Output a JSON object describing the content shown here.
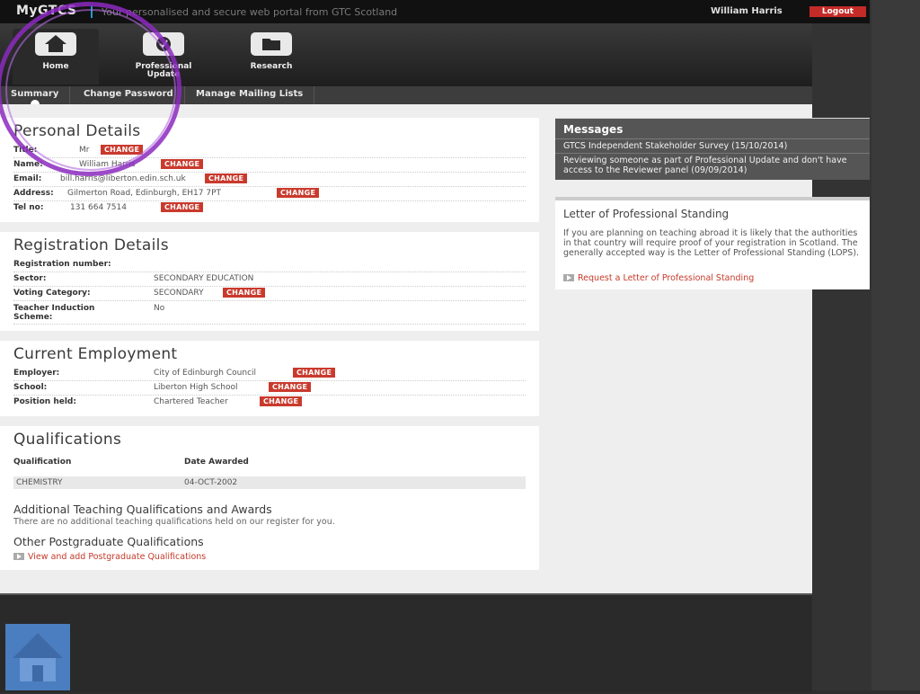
{
  "header": {
    "logo": "MyGTCS",
    "tagline": "Your personalised and secure web portal from GTC Scotland",
    "username": "William Harris",
    "logout": "Logout"
  },
  "nav": [
    {
      "label": "Home",
      "icon": "home-icon"
    },
    {
      "label": "Professional Update",
      "icon": "professional-update-icon"
    },
    {
      "label": "Research",
      "icon": "folder-icon"
    }
  ],
  "subtabs": [
    "Summary",
    "Change Password",
    "Manage Mailing Lists"
  ],
  "change_label": "CHANGE",
  "personal": {
    "title": "Personal Details",
    "rows": [
      {
        "label": "Title:",
        "value": "Mr"
      },
      {
        "label": "Name:",
        "value": "William Harris"
      },
      {
        "label": "Email:",
        "value": "bill.harris@liberton.edin.sch.uk"
      },
      {
        "label": "Address:",
        "value": "Gilmerton Road, Edinburgh, EH17 7PT"
      },
      {
        "label": "Tel no:",
        "value": "131 664 7514"
      }
    ]
  },
  "registration": {
    "title": "Registration Details",
    "rows": [
      {
        "label": "Registration number:",
        "value": ""
      },
      {
        "label": "Sector:",
        "value": "SECONDARY EDUCATION"
      },
      {
        "label": "Voting Category:",
        "value": "SECONDARY"
      },
      {
        "label": "Teacher Induction Scheme:",
        "value": "No"
      }
    ]
  },
  "employment": {
    "title": "Current Employment",
    "rows": [
      {
        "label": "Employer:",
        "value": "City of Edinburgh Council"
      },
      {
        "label": "School:",
        "value": "Liberton High School"
      },
      {
        "label": "Position held:",
        "value": "Chartered Teacher"
      }
    ]
  },
  "qualifications": {
    "title": "Qualifications",
    "col_qual": "Qualification",
    "col_date": "Date Awarded",
    "rows": [
      {
        "qualification": "CHEMISTRY",
        "date": "04-OCT-2002"
      }
    ],
    "additional_title": "Additional Teaching Qualifications and Awards",
    "additional_text": "There are no additional teaching qualifications held on our register for you.",
    "postgrad_title": "Other Postgraduate Qualifications",
    "postgrad_link": "View and add Postgraduate Qualifications"
  },
  "messages": {
    "title": "Messages",
    "items": [
      "GTCS Independent Stakeholder Survey (15/10/2014)",
      "Reviewing someone as part of Professional Update and don't have access to the Reviewer panel (09/09/2014)"
    ]
  },
  "lops": {
    "title": "Letter of Professional Standing",
    "text": "If you are planning on teaching abroad it is likely that the authorities in that country will require proof of your registration in Scotland. The generally accepted way is the Letter of Professional Standing (LOPS).",
    "link": "Request a Letter of Professional Standing"
  },
  "colors": {
    "accent": "#c93a2d",
    "logout": "#c32b28",
    "annotation": "#8c2ac0",
    "home_corner": "#4a7ec0"
  }
}
